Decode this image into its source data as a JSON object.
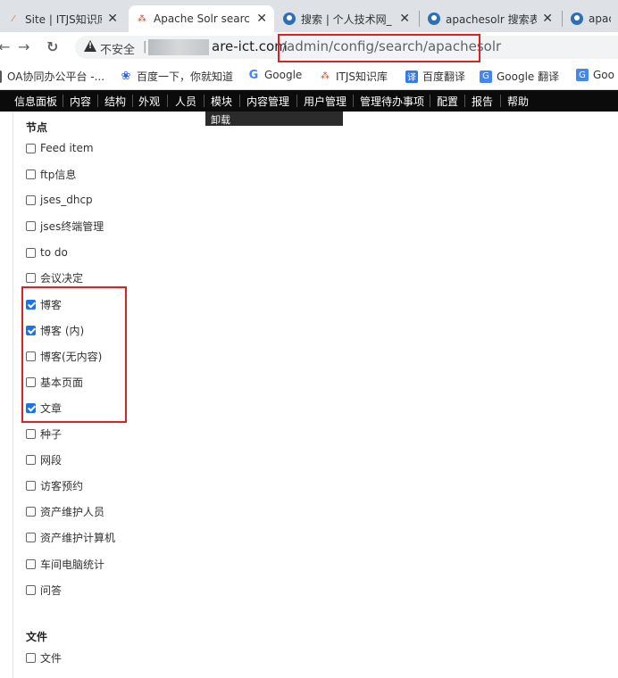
{
  "tabs": [
    {
      "label": "Site | ITJS知识库",
      "icon": "site-favicon-icon"
    },
    {
      "label": "Apache Solr searc",
      "icon": "solr-favicon-icon",
      "active": true
    },
    {
      "label": "搜索 | 个人技术网_",
      "icon": "drupal-drop-icon"
    },
    {
      "label": "apachesolr 搜索表",
      "icon": "drupal-drop-icon"
    },
    {
      "label": "apach",
      "icon": "drupal-drop-icon"
    }
  ],
  "address": {
    "security_label": "不安全",
    "separator": "|",
    "host_visible": "are-ict.com",
    "path": "/admin/config/search/apachesolr"
  },
  "bookmarks": [
    {
      "label": "OA协同办公平台 -...",
      "icon": "folder-icon"
    },
    {
      "label": "百度一下，你就知道",
      "icon": "baidu-paw-icon"
    },
    {
      "label": "Google",
      "icon": "google-g-icon"
    },
    {
      "label": "ITJS知识库",
      "icon": "solr-favicon-icon"
    },
    {
      "label": "百度翻译",
      "icon": "baidu-translate-icon"
    },
    {
      "label": "Google 翻译",
      "icon": "google-translate-icon"
    },
    {
      "label": "Goo",
      "icon": "google-translate-icon"
    }
  ],
  "admin_menu": [
    "信息面板",
    "内容",
    "结构",
    "外观",
    "人员",
    "模块",
    "内容管理",
    "用户管理",
    "管理待办事项",
    "配置",
    "报告",
    "帮助"
  ],
  "submenu_label": "卸载",
  "sections": [
    {
      "title": "节点",
      "options": [
        {
          "label": "Feed item",
          "checked": false
        },
        {
          "label": "ftp信息",
          "checked": false
        },
        {
          "label": "jses_dhcp",
          "checked": false
        },
        {
          "label": "jses终端管理",
          "checked": false
        },
        {
          "label": "to do",
          "checked": false
        },
        {
          "label": "会议决定",
          "checked": false
        },
        {
          "label": "博客",
          "checked": true
        },
        {
          "label": "博客 (内)",
          "checked": true
        },
        {
          "label": "博客(无内容)",
          "checked": false
        },
        {
          "label": "基本页面",
          "checked": false
        },
        {
          "label": "文章",
          "checked": true
        },
        {
          "label": "种子",
          "checked": false
        },
        {
          "label": "网段",
          "checked": false
        },
        {
          "label": "访客预约",
          "checked": false
        },
        {
          "label": "资产维护人员",
          "checked": false
        },
        {
          "label": "资产维护计算机",
          "checked": false
        },
        {
          "label": "车间电脑统计",
          "checked": false
        },
        {
          "label": "问答",
          "checked": false
        }
      ]
    },
    {
      "title": "文件",
      "options": [
        {
          "label": "文件",
          "checked": false
        }
      ]
    }
  ],
  "colors": {
    "accent": "#1a73e8",
    "highlight": "#e02020",
    "admin_bar": "#0b0b0b"
  }
}
